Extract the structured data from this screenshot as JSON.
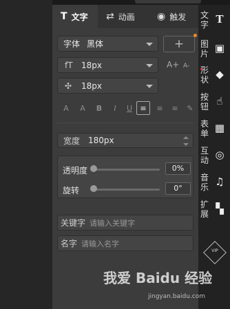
{
  "tabs": [
    {
      "icon": "T",
      "label": "文字"
    },
    {
      "icon": "⇄",
      "label": "动画"
    },
    {
      "icon": "◉",
      "label": "触发"
    }
  ],
  "font": {
    "label": "字体",
    "value": "黑体",
    "add_symbol": "+"
  },
  "size": {
    "icon": "fT",
    "value": "18px",
    "grow": "A+",
    "shrink": "A-"
  },
  "spacing": {
    "icon": "✣",
    "value": "18px"
  },
  "format_buttons": [
    "A",
    "A",
    "B",
    "I",
    "U",
    "≡",
    "≡",
    "≡",
    "✎"
  ],
  "width": {
    "label": "宽度",
    "value": "180px"
  },
  "opacity": {
    "label": "透明度",
    "value": "0%",
    "level": 0
  },
  "rotation": {
    "label": "旋转",
    "value": "0°",
    "level": 0
  },
  "keyword": {
    "label": "关键字",
    "placeholder": "请输入关键字"
  },
  "name": {
    "label": "名字",
    "placeholder": "请输入名字"
  },
  "rail": [
    {
      "label": "文字",
      "icon": "T"
    },
    {
      "label": "图片",
      "icon": "▣"
    },
    {
      "label": "形状",
      "icon": "◆"
    },
    {
      "label": "按钮",
      "icon": "☝"
    },
    {
      "label": "表单",
      "icon": "▦"
    },
    {
      "label": "互动",
      "icon": "◎"
    },
    {
      "label": "音乐",
      "icon": "♫"
    },
    {
      "label": "扩展",
      "icon": "▚"
    }
  ],
  "vip": "VIP",
  "watermark": {
    "text": "我爱 Baidu 经验",
    "url": "jingyan.baidu.com"
  }
}
